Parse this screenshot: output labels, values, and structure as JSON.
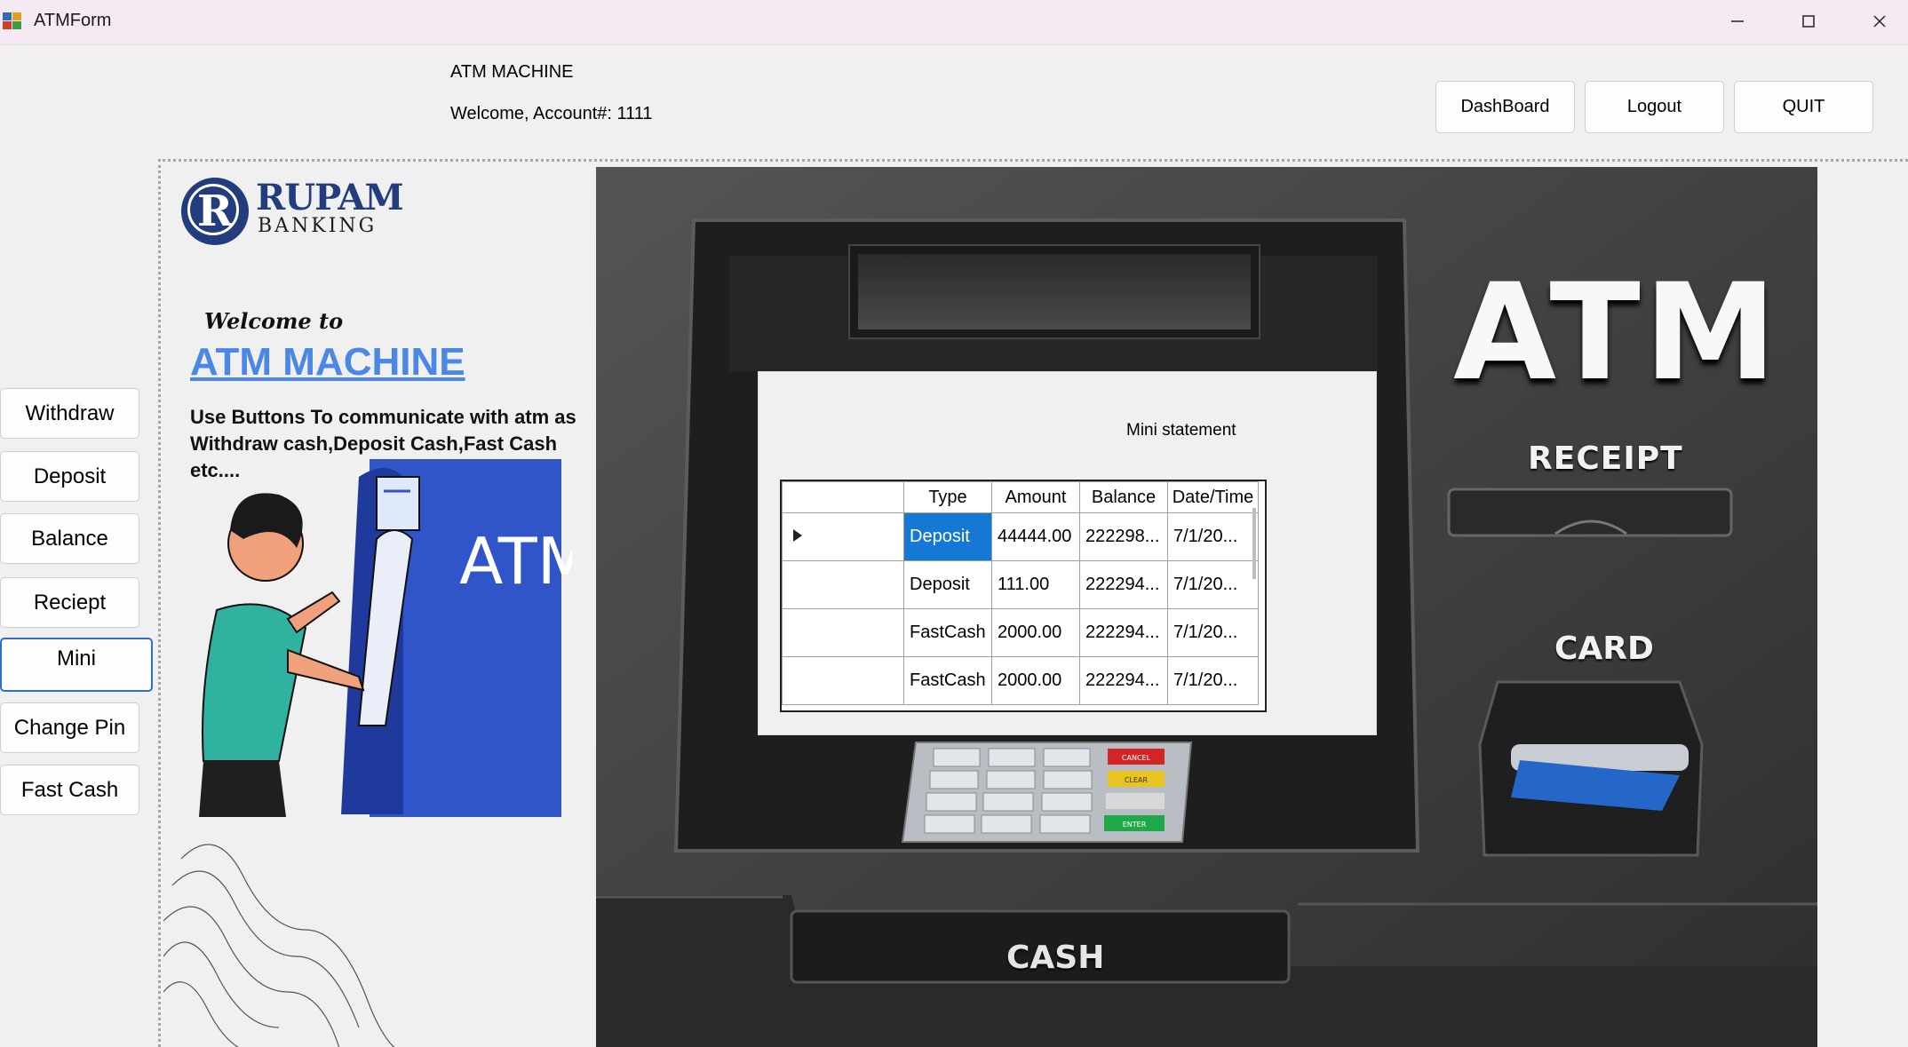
{
  "window": {
    "title": "ATMForm"
  },
  "header": {
    "title": "ATM MACHINE",
    "welcome": "Welcome, Account#: 1111"
  },
  "top_buttons": {
    "dashboard": "DashBoard",
    "logout": "Logout",
    "quit": "QUIT"
  },
  "side_buttons": {
    "withdraw": "Withdraw",
    "deposit": "Deposit",
    "balance": "Balance",
    "reciept": "Reciept",
    "mini": "Mini",
    "change_pin": "Change Pin",
    "fast_cash": "Fast Cash"
  },
  "brand": {
    "logo_letter": "R",
    "name": "RUPAM",
    "sub": "BANKING"
  },
  "intro": {
    "welcome_to": "Welcome to",
    "heading": "ATM MACHINE",
    "text": "Use Buttons To communicate with atm as Withdraw cash,Deposit Cash,Fast Cash etc....",
    "poster_text": "ATM"
  },
  "machine": {
    "atm_label": "ATM",
    "receipt_label": "RECEIPT",
    "card_label": "CARD",
    "cash_label": "CASH",
    "keypad_cancel": "CANCEL",
    "keypad_clear": "CLEAR",
    "keypad_enter": "ENTER"
  },
  "mini_statement": {
    "title": "Mini statement",
    "columns": [
      "Type",
      "Amount",
      "Balance",
      "Date/Time"
    ],
    "rows": [
      {
        "type": "Deposit",
        "amount": "44444.00",
        "balance": "222298...",
        "date": "7/1/20..."
      },
      {
        "type": "Deposit",
        "amount": "111.00",
        "balance": "222294...",
        "date": "7/1/20..."
      },
      {
        "type": "FastCash",
        "amount": "2000.00",
        "balance": "222294...",
        "date": "7/1/20..."
      },
      {
        "type": "FastCash",
        "amount": "2000.00",
        "balance": "222294...",
        "date": "7/1/20..."
      }
    ]
  },
  "colors": {
    "accent": "#2d6dd2",
    "selected_cell": "#1478d4",
    "brand_blue": "#233d7c",
    "heading_blue": "#4a87e6"
  }
}
